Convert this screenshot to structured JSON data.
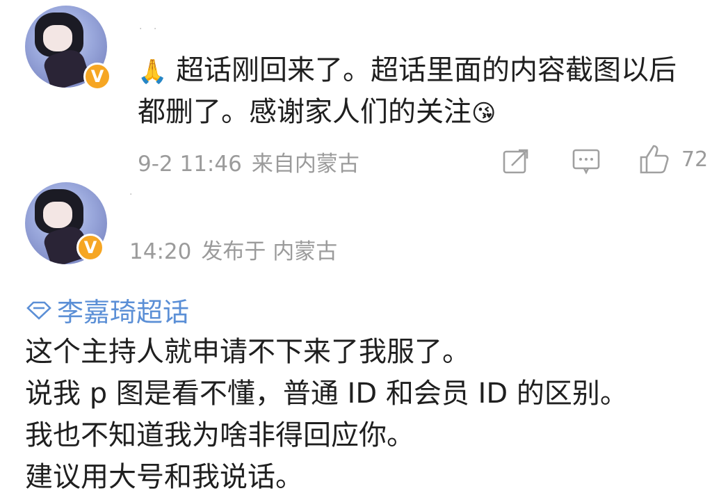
{
  "comment": {
    "text_line1": "超话刚回来了。超话里面的内容截图以后",
    "text_line2": "都删了。感谢家人们的关注",
    "emoji_prefix": "🙏",
    "emoji_suffix": "😘",
    "date": "9-2 11:46",
    "location": "来自内蒙古",
    "like_count": "72",
    "badge_label": "V",
    "icons": [
      "forward-icon",
      "comment-icon",
      "like-icon"
    ]
  },
  "post": {
    "time": "14:20",
    "location": "发布于 内蒙古",
    "badge_label": "V",
    "topic": "李嘉琦超话",
    "lines": [
      "这个主持人就申请不下来了我服了。",
      "说我 p 图是看不懂，普通 ID 和会员 ID 的区别。",
      "我也不知道我为啥非得回应你。",
      "建议用大号和我说话。"
    ]
  },
  "colors": {
    "text": "#1f1f1f",
    "meta": "#9b9b9b",
    "topic": "#5b8fd6",
    "badge": "#f6a623"
  }
}
